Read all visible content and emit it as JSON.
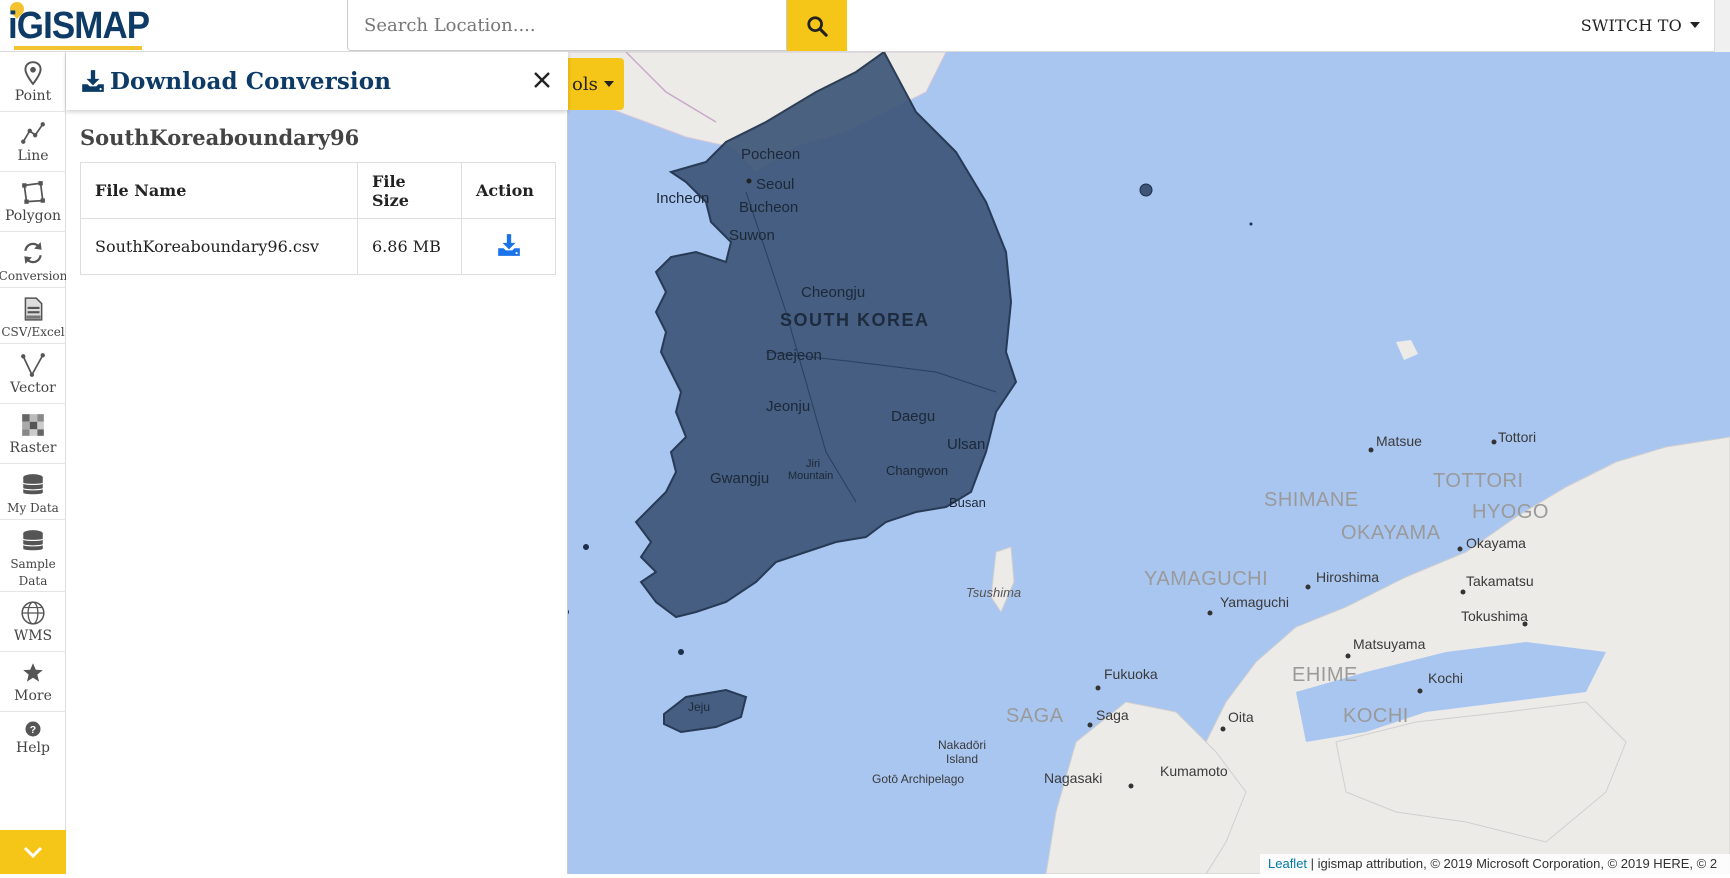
{
  "header": {
    "logo_text": "iGISMAP",
    "search_placeholder": "Search Location....",
    "switch_to_label": "SWITCH TO"
  },
  "sidebar": {
    "tools": [
      {
        "label": "Point",
        "icon": "map-pin-icon"
      },
      {
        "label": "Line",
        "icon": "polyline-icon"
      },
      {
        "label": "Polygon",
        "icon": "polygon-icon"
      },
      {
        "label": "Conversion",
        "icon": "conversion-icon"
      },
      {
        "label": "CSV/Excel",
        "icon": "csv-file-icon"
      },
      {
        "label": "Vector",
        "icon": "vector-icon"
      },
      {
        "label": "Raster",
        "icon": "raster-icon"
      },
      {
        "label": "My Data",
        "icon": "database-icon"
      },
      {
        "label": "Sample Data",
        "icon": "database-icon"
      },
      {
        "label": "WMS",
        "icon": "wms-globe-icon"
      },
      {
        "label": "More",
        "icon": "star-icon"
      },
      {
        "label": "Help",
        "icon": "help-icon"
      }
    ]
  },
  "panel": {
    "title": "Download Conversion",
    "dataset_name": "SouthKoreaboundary96",
    "table": {
      "headers": [
        "File Name",
        "File Size",
        "Action"
      ],
      "rows": [
        {
          "file_name": "SouthKoreaboundary96.csv",
          "file_size": "6.86 MB"
        }
      ]
    }
  },
  "map": {
    "tools_button_label": "ols",
    "labels": {
      "country": "SOUTH KOREA",
      "pocheon": "Pocheon",
      "seoul": "Seoul",
      "incheon": "Incheon",
      "bucheon": "Bucheon",
      "suwon": "Suwon",
      "cheongju": "Cheongju",
      "daejeon": "Daejeon",
      "jeonju": "Jeonju",
      "daegu": "Daegu",
      "ulsan": "Ulsan",
      "gwangju": "Gwangju",
      "jiri": "Jiri",
      "mountain": "Mountain",
      "changwon": "Changwon",
      "busan": "Busan",
      "jeju": "Jeju",
      "tsushima": "Tsushima",
      "matsue": "Matsue",
      "tottori_city": "Tottori",
      "shimane": "SHIMANE",
      "tottori": "TOTTORI",
      "hyogo": "HYOGO",
      "okayama_pref": "OKAYAMA",
      "okayama": "Okayama",
      "yamaguchi_pref": "YAMAGUCHI",
      "hiroshima": "Hiroshima",
      "takamatsu": "Takamatsu",
      "yamaguchi": "Yamaguchi",
      "tokushima": "Tokushima",
      "matsuyama": "Matsuyama",
      "ehime": "EHIME",
      "kochi": "Kochi",
      "kochi_pref": "KOCHI",
      "fukuoka": "Fukuoka",
      "saga_pref": "SAGA",
      "saga": "Saga",
      "oita": "Oita",
      "nakadori": "Nakadōri",
      "island": "Island",
      "goto": "Gotō Archipelago",
      "nagasaki": "Nagasaki",
      "kumamoto": "Kumamoto"
    },
    "attribution_link": "Leaflet",
    "attribution_text": " | igismap attribution, © 2019 Microsoft Corporation, © 2019 HERE, © 2"
  },
  "colors": {
    "accent_yellow": "#f5c518",
    "brand_navy": "#0d3b66",
    "water": "#a9c6f0",
    "boundary_fill": "#3d5678",
    "download_blue": "#1a73e8"
  }
}
